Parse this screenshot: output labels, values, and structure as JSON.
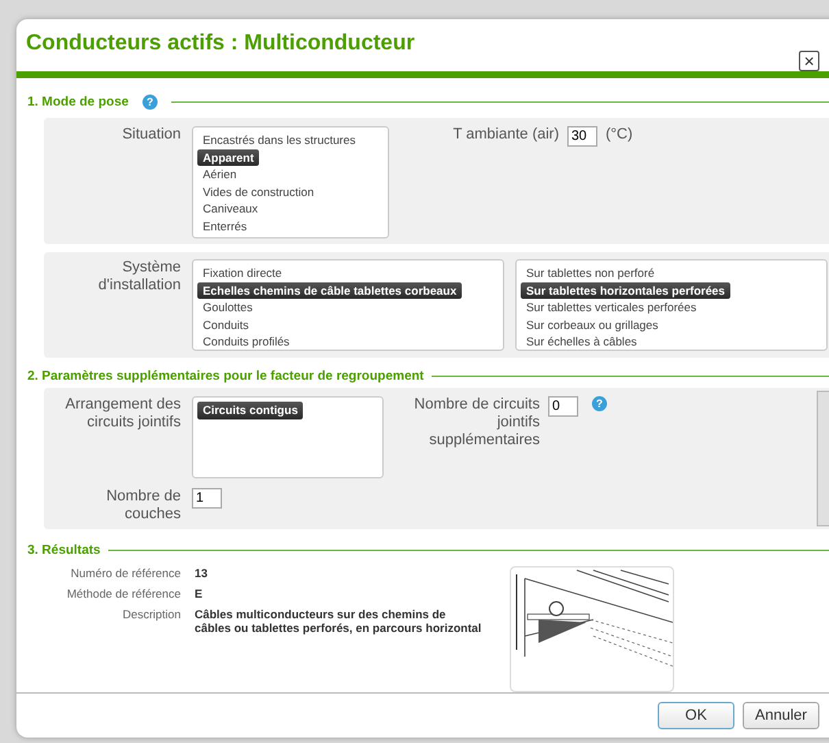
{
  "dialog": {
    "title": "Conducteurs actifs : Multiconducteur",
    "close": "×"
  },
  "section1": {
    "heading": "1. Mode de pose",
    "help": "?",
    "situation": {
      "label": "Situation",
      "options": [
        {
          "label": "Encastrés dans les structures",
          "selected": false
        },
        {
          "label": "Apparent",
          "selected": true
        },
        {
          "label": "Aérien",
          "selected": false
        },
        {
          "label": "Vides de construction",
          "selected": false
        },
        {
          "label": "Caniveaux",
          "selected": false
        },
        {
          "label": "Enterrés",
          "selected": false
        }
      ]
    },
    "temperature": {
      "label": "T ambiante (air)",
      "value": "30",
      "unit": "(°C)"
    },
    "system": {
      "label": "Système d'installation",
      "options": [
        {
          "label": "Fixation directe",
          "selected": false
        },
        {
          "label": "Echelles chemins de câble tablettes corbeaux",
          "selected": true
        },
        {
          "label": "Goulottes",
          "selected": false
        },
        {
          "label": "Conduits",
          "selected": false
        },
        {
          "label": "Conduits profilés",
          "selected": false
        }
      ],
      "suboptions": [
        {
          "label": "Sur tablettes non perforé",
          "selected": false
        },
        {
          "label": "Sur tablettes horizontales perforées",
          "selected": true
        },
        {
          "label": "Sur tablettes verticales perforées",
          "selected": false
        },
        {
          "label": "Sur corbeaux ou grillages",
          "selected": false
        },
        {
          "label": "Sur échelles à câbles",
          "selected": false
        }
      ]
    }
  },
  "section2": {
    "heading": "2. Paramètres supplémentaires pour le facteur de regroupement",
    "arrangement": {
      "label": "Arrangement des circuits jointifs",
      "options": [
        {
          "label": "Circuits contigus",
          "selected": true
        }
      ]
    },
    "circuits": {
      "label": "Nombre de circuits jointifs supplémentaires",
      "value": "0",
      "help": "?"
    },
    "layers": {
      "label": "Nombre de couches",
      "value": "1"
    }
  },
  "section3": {
    "heading": "3. Résultats",
    "rows": [
      {
        "label": "Numéro de référence",
        "value": "13"
      },
      {
        "label": "Méthode de référence",
        "value": "E"
      },
      {
        "label": "Description",
        "value": "Câbles multiconducteurs sur des chemins de câbles ou tablettes perforés, en parcours horizontal"
      }
    ]
  },
  "buttons": [
    {
      "label": "OK",
      "kind": "primary"
    },
    {
      "label": "Annuler",
      "kind": "secondary"
    }
  ]
}
